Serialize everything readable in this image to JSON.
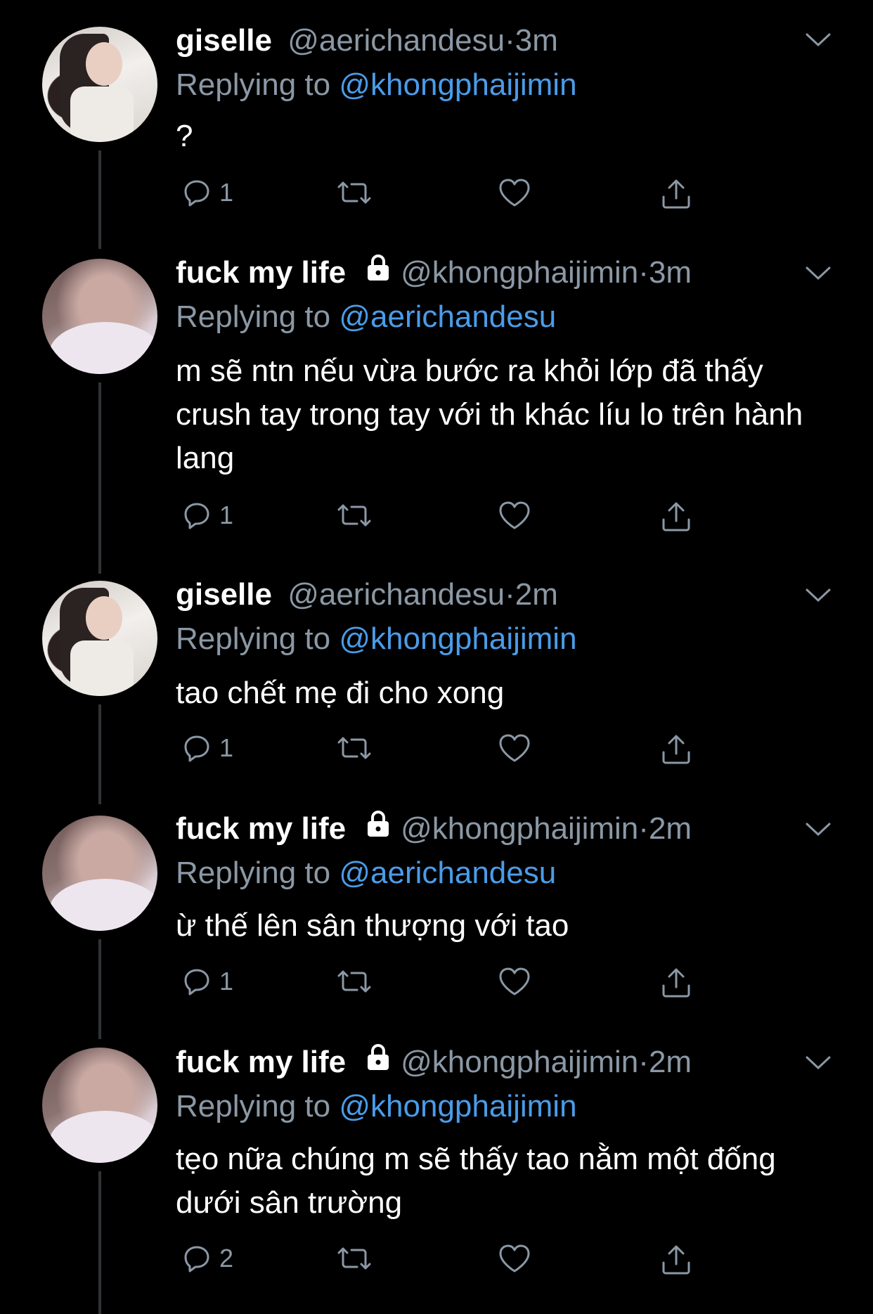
{
  "tweets": [
    {
      "name": "giselle",
      "handle": "@aerichandesu",
      "dot": "·",
      "time": "3m",
      "protected": false,
      "replying_prefix": "Replying to ",
      "replying_to": "@khongphaijimin",
      "text": "?",
      "replies": "1",
      "avatar": "giselle-avatar"
    },
    {
      "name": "fuck my life",
      "handle": "@khongphaijimin",
      "dot": "·",
      "time": "3m",
      "protected": true,
      "replying_prefix": "Replying to ",
      "replying_to": "@aerichandesu",
      "text": "m sẽ ntn nếu vừa bước ra khỏi lớp đã thấy crush tay trong tay với th khác líu lo trên hành lang",
      "replies": "1",
      "avatar": "fml-avatar"
    },
    {
      "name": "giselle",
      "handle": "@aerichandesu",
      "dot": "·",
      "time": "2m",
      "protected": false,
      "replying_prefix": "Replying to ",
      "replying_to": "@khongphaijimin",
      "text": "tao chết mẹ đi cho xong",
      "replies": "1",
      "avatar": "giselle-avatar"
    },
    {
      "name": "fuck my life",
      "handle": "@khongphaijimin",
      "dot": "·",
      "time": "2m",
      "protected": true,
      "replying_prefix": "Replying to ",
      "replying_to": "@aerichandesu",
      "text": "ừ thế lên sân thượng với tao",
      "replies": "1",
      "avatar": "fml-avatar"
    },
    {
      "name": "fuck my life",
      "handle": "@khongphaijimin",
      "dot": "·",
      "time": "2m",
      "protected": true,
      "replying_prefix": "Replying to ",
      "replying_to": "@khongphaijimin",
      "text": "tẹo nữa chúng m sẽ thấy tao nằm một đống dưới sân trường",
      "replies": "2",
      "avatar": "fml-avatar"
    }
  ],
  "icons": {
    "reply": "reply-icon",
    "retweet": "retweet-icon",
    "like": "heart-icon",
    "share": "share-icon",
    "more": "chevron-down-icon",
    "protected": "lock-icon"
  },
  "colors": {
    "background": "#000000",
    "text": "#ffffff",
    "secondary": "#8b98a5",
    "mention": "#4a9ce8",
    "thread_line": "#2f3336"
  }
}
